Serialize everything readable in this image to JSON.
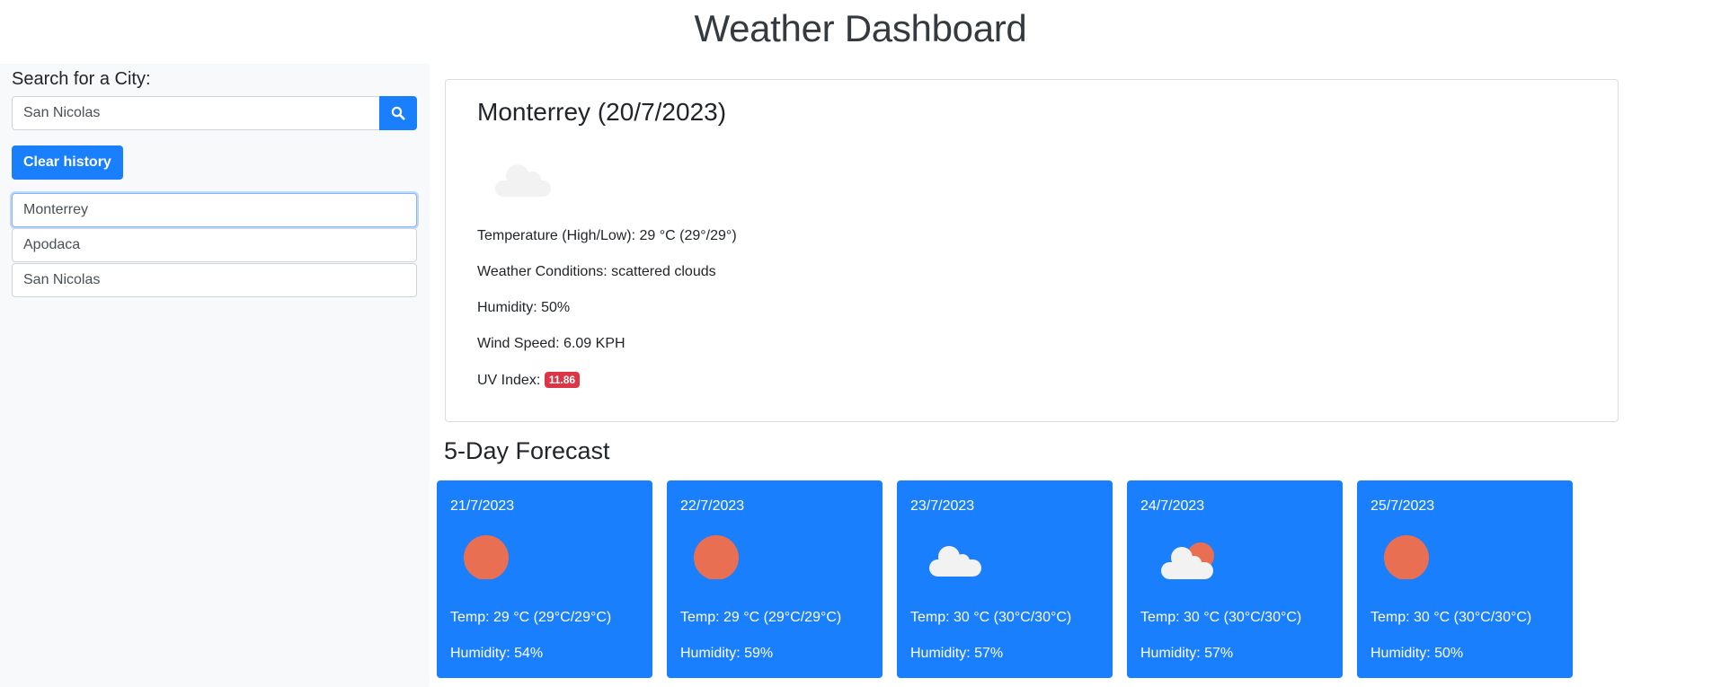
{
  "header": {
    "title": "Weather Dashboard"
  },
  "sidebar": {
    "search_label": "Search for a City:",
    "search_value": "San Nicolas",
    "search_icon": "search-icon",
    "clear_button": "Clear history",
    "history": [
      {
        "label": "Monterrey",
        "active": true
      },
      {
        "label": "Apodaca",
        "active": false
      },
      {
        "label": "San Nicolas",
        "active": false
      }
    ]
  },
  "current": {
    "title": "Monterrey (20/7/2023)",
    "icon": "cloud-icon",
    "temperature": "Temperature (High/Low): 29 °C (29°/29°)",
    "conditions": "Weather Conditions: scattered clouds",
    "humidity": "Humidity: 50%",
    "wind": "Wind Speed: 6.09 KPH",
    "uv_label": "UV Index:",
    "uv_value": "11.86",
    "uv_color": "#dc3545"
  },
  "forecast": {
    "title": "5-Day Forecast",
    "accent": "#1a7ffc",
    "days": [
      {
        "date": "21/7/2023",
        "icon": "sun",
        "temp": "Temp: 29 °C (29°C/29°C)",
        "humidity": "Humidity: 54%"
      },
      {
        "date": "22/7/2023",
        "icon": "sun",
        "temp": "Temp: 29 °C (29°C/29°C)",
        "humidity": "Humidity: 59%"
      },
      {
        "date": "23/7/2023",
        "icon": "cloud",
        "temp": "Temp: 30 °C (30°C/30°C)",
        "humidity": "Humidity: 57%"
      },
      {
        "date": "24/7/2023",
        "icon": "sun-cloud",
        "temp": "Temp: 30 °C (30°C/30°C)",
        "humidity": "Humidity: 57%"
      },
      {
        "date": "25/7/2023",
        "icon": "sun",
        "temp": "Temp: 30 °C (30°C/30°C)",
        "humidity": "Humidity: 50%"
      }
    ]
  }
}
